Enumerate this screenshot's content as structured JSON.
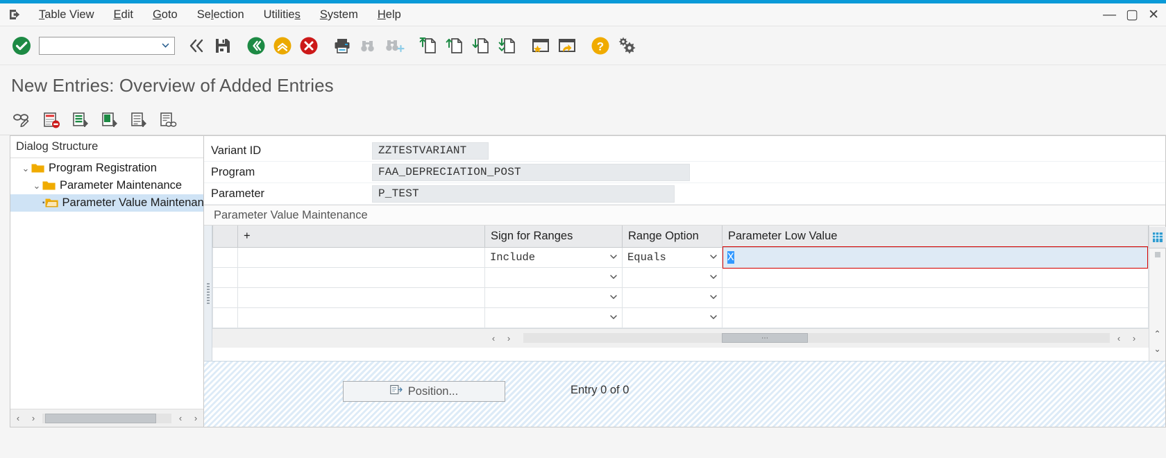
{
  "window": {
    "minimize": "—",
    "maximize": "▢",
    "close": "✕"
  },
  "menu": {
    "system_icon": "session-icon",
    "items": [
      {
        "pre": "",
        "acc": "T",
        "post": "able View",
        "name": "menu-table-view"
      },
      {
        "pre": "",
        "acc": "E",
        "post": "dit",
        "name": "menu-edit"
      },
      {
        "pre": "",
        "acc": "G",
        "post": "oto",
        "name": "menu-goto"
      },
      {
        "pre": "Se",
        "acc": "l",
        "post": "ection",
        "name": "menu-selection"
      },
      {
        "pre": "Utilitie",
        "acc": "s",
        "post": "",
        "name": "menu-utilities"
      },
      {
        "pre": "",
        "acc": "S",
        "post": "ystem",
        "name": "menu-system"
      },
      {
        "pre": "",
        "acc": "H",
        "post": "elp",
        "name": "menu-help"
      }
    ]
  },
  "toolbar": {
    "command_value": "",
    "command_placeholder": "",
    "buttons": [
      {
        "name": "enter-icon",
        "title": "Continue (Enter)"
      },
      {
        "name": "back-double-chevron-icon",
        "title": "Back"
      },
      {
        "name": "save-icon",
        "title": "Save"
      },
      {
        "name": "back-icon",
        "title": "Back (F3)"
      },
      {
        "name": "exit-icon",
        "title": "Exit"
      },
      {
        "name": "cancel-icon",
        "title": "Cancel (F12)"
      },
      {
        "name": "print-icon",
        "title": "Print"
      },
      {
        "name": "find-icon",
        "title": "Find"
      },
      {
        "name": "find-next-icon",
        "title": "Find Next"
      },
      {
        "name": "first-page-icon",
        "title": "First Page"
      },
      {
        "name": "previous-page-icon",
        "title": "Previous Page"
      },
      {
        "name": "next-page-icon",
        "title": "Next Page"
      },
      {
        "name": "last-page-icon",
        "title": "Last Page"
      },
      {
        "name": "create-session-icon",
        "title": "Create Session"
      },
      {
        "name": "create-shortcut-icon",
        "title": "Create Shortcut"
      },
      {
        "name": "help-icon",
        "title": "Help"
      },
      {
        "name": "customize-local-layout-icon",
        "title": "Customize Local Layout"
      }
    ]
  },
  "page": {
    "title": "New Entries: Overview of Added Entries"
  },
  "app_toolbar": {
    "buttons": [
      {
        "name": "display-change-icon",
        "title": "Display/Change"
      },
      {
        "name": "delete-row-icon",
        "title": "Delete Row"
      },
      {
        "name": "select-all-icon",
        "title": "Select All"
      },
      {
        "name": "select-block-icon",
        "title": "Select Block"
      },
      {
        "name": "deselect-all-icon",
        "title": "Deselect All"
      },
      {
        "name": "search-entries-icon",
        "title": "Search"
      }
    ]
  },
  "tree": {
    "header": "Dialog Structure",
    "nodes": [
      {
        "label": "Program Registration",
        "indent": 1,
        "twisty": "⌄",
        "selected": false,
        "name": "tree-node-program-registration"
      },
      {
        "label": "Parameter Maintenance",
        "indent": 2,
        "twisty": "⌄",
        "selected": false,
        "name": "tree-node-parameter-maintenance"
      },
      {
        "label": "Parameter Value Maintenan",
        "indent": 3,
        "twisty": "▪",
        "selected": true,
        "name": "tree-node-parameter-value-maintenance"
      }
    ],
    "scroll_left": "‹",
    "scroll_right": "›"
  },
  "form": {
    "rows": [
      {
        "label": "Variant ID",
        "value": "ZZTESTVARIANT",
        "name": "variant-id"
      },
      {
        "label": "Program",
        "value": "FAA_DEPRECIATION_POST",
        "name": "program"
      },
      {
        "label": "Parameter",
        "value": "P_TEST",
        "name": "parameter"
      }
    ]
  },
  "table": {
    "caption": "Parameter Value Maintenance",
    "columns": [
      "",
      "+",
      "Sign for Ranges",
      "Range Option",
      "Parameter Low Value"
    ],
    "rows": [
      {
        "plus": "",
        "sign": "Include",
        "range": "Equals",
        "low": "X",
        "focused": true
      },
      {
        "plus": "",
        "sign": "",
        "range": "",
        "low": "",
        "focused": false
      },
      {
        "plus": "",
        "sign": "",
        "range": "",
        "low": "",
        "focused": false
      },
      {
        "plus": "",
        "sign": "",
        "range": "",
        "low": "",
        "focused": false
      }
    ],
    "chevron": "⌄",
    "scroll_left": "‹",
    "scroll_right": "›",
    "scroll_up": "⌃",
    "scroll_down": "⌄",
    "config_icon": "table-settings-icon"
  },
  "footer": {
    "position_label": "Position...",
    "position_icon": "position-icon",
    "entry_count": "Entry 0 of 0"
  },
  "colors": {
    "accent_blue": "#0a9ad8",
    "green": "#198038",
    "yellow": "#f0ab00",
    "red": "#cc1919",
    "selection": "#cfe3f5",
    "focus_red": "#d40000"
  }
}
